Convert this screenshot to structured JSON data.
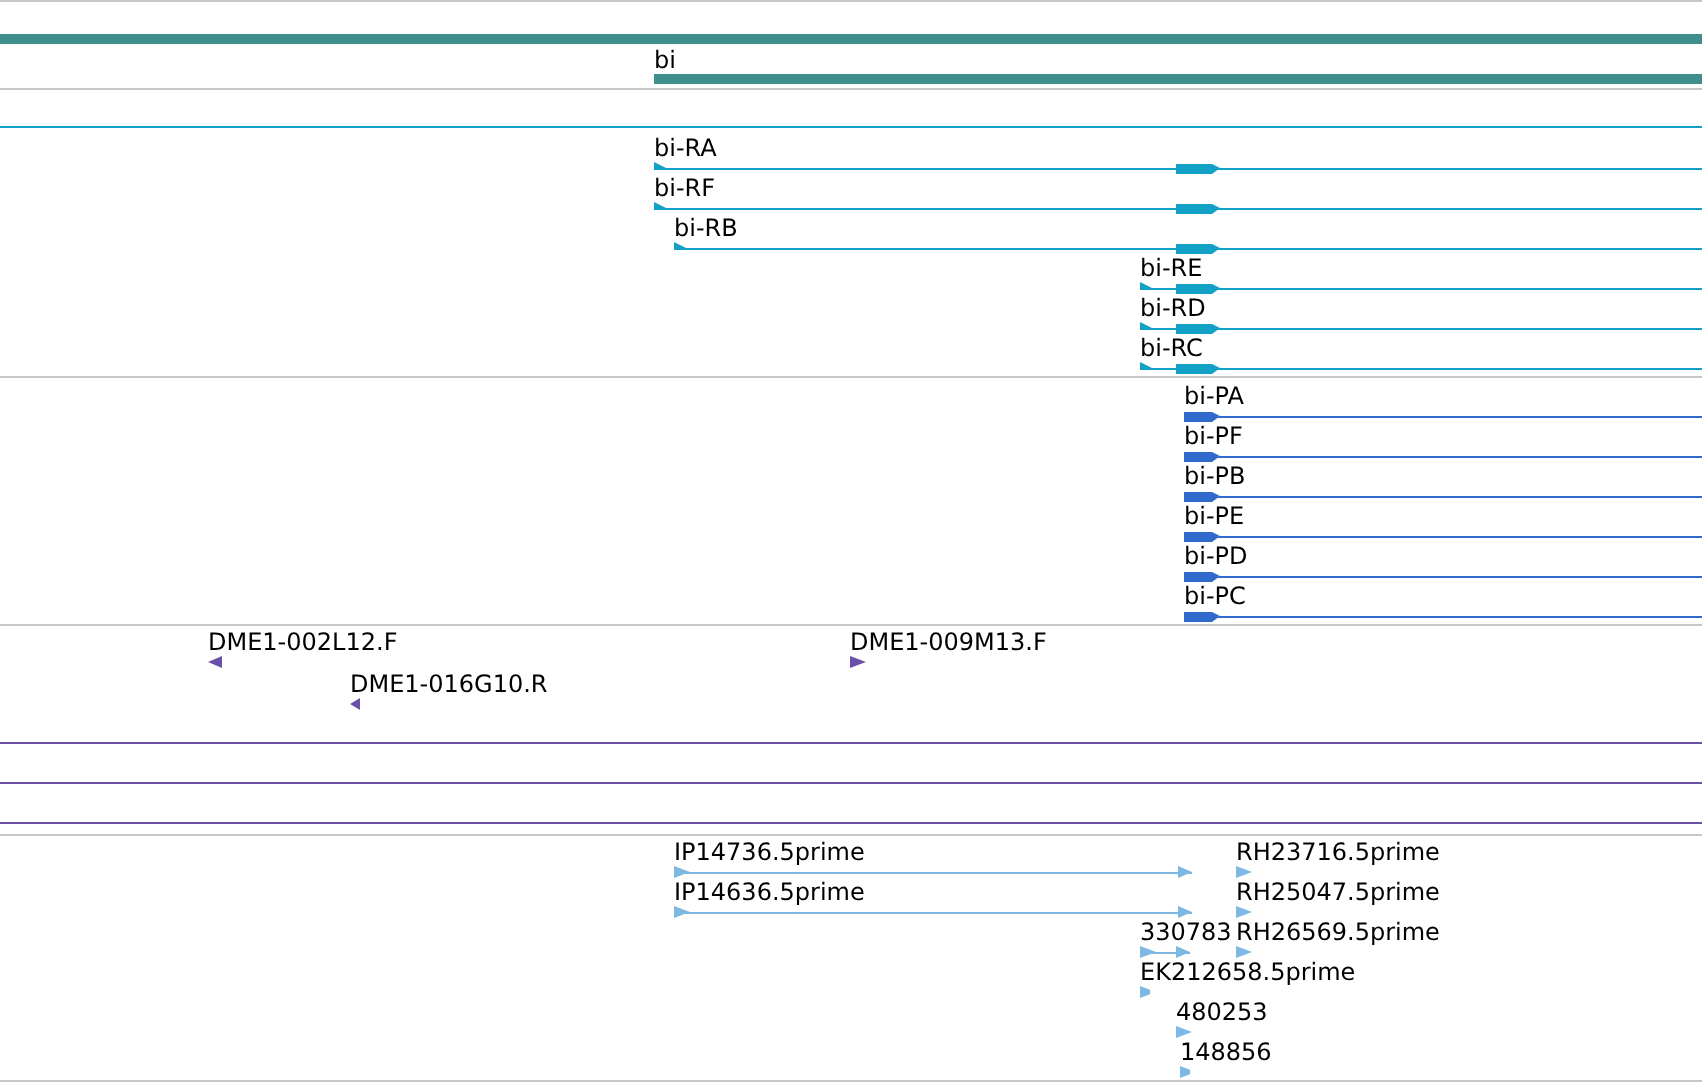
{
  "tracks": [
    {
      "kind": "gene",
      "features": [
        {
          "label": "bi"
        }
      ]
    },
    {
      "kind": "transcript",
      "features": [
        {
          "label": "bi-RA"
        },
        {
          "label": "bi-RF"
        },
        {
          "label": "bi-RB"
        },
        {
          "label": "bi-RE"
        },
        {
          "label": "bi-RD"
        },
        {
          "label": "bi-RC"
        }
      ]
    },
    {
      "kind": "protein",
      "features": [
        {
          "label": "bi-PA"
        },
        {
          "label": "bi-PF"
        },
        {
          "label": "bi-PB"
        },
        {
          "label": "bi-PE"
        },
        {
          "label": "bi-PD"
        },
        {
          "label": "bi-PC"
        }
      ]
    },
    {
      "kind": "probe",
      "features": [
        {
          "label": "DME1-002L12.F",
          "reverse": true
        },
        {
          "label": "DME1-016G10.R",
          "reverse": true
        },
        {
          "label": "DME1-009M13.F",
          "reverse": false
        }
      ]
    },
    {
      "kind": "est",
      "features": [
        {
          "label": "IP14736.5prime"
        },
        {
          "label": "IP14636.5prime"
        },
        {
          "label": "RH23716.5prime"
        },
        {
          "label": "RH25047.5prime"
        },
        {
          "label": "330783"
        },
        {
          "label": "RH26569.5prime"
        },
        {
          "label": "EK212658.5prime"
        },
        {
          "label": "480253"
        },
        {
          "label": "148856"
        }
      ]
    }
  ]
}
